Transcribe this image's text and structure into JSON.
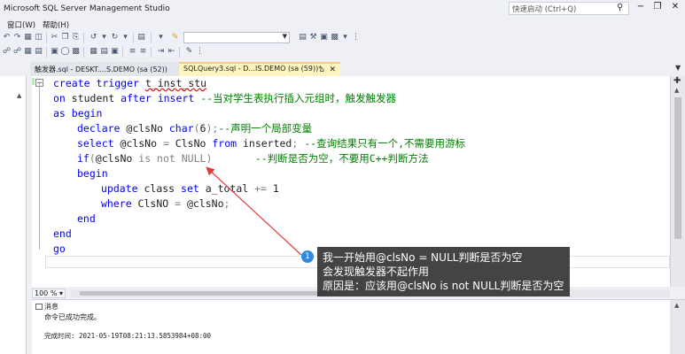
{
  "window": {
    "title": "Microsoft SQL Server Management Studio",
    "quick_launch_placeholder": "快速启动 (Ctrl+Q)",
    "minimize": "−",
    "restore": "❐",
    "close": "✕"
  },
  "menu": {
    "items": [
      "窗口(W)",
      "帮助(H)"
    ]
  },
  "tabs": {
    "inactive_label": "触发器.sql - DESKT....S.DEMO (sa (52))",
    "active_label": "SQLQuery3.sql - D...IS.DEMO (sa (59))*",
    "pin": "⌂",
    "close": "✕",
    "left_pin": "⌂ ✕"
  },
  "code": {
    "l1": {
      "kw1": "create trigger ",
      "name": "t_inst_stu"
    },
    "l2": {
      "kw1": "on ",
      "t1": "student ",
      "kw2": "after insert ",
      "cm": "--当对学生表执行插入元组时，触发触发器"
    },
    "l3": {
      "kw1": "as begin"
    },
    "l4": {
      "kw1": "declare ",
      "t1": "@clsNo ",
      "kw2": "char",
      "p1": "(",
      "n": "6",
      "p2": ");",
      "cm": "--声明一个局部变量"
    },
    "l5": {
      "kw1": "select ",
      "t1": "@clsNo ",
      "p1": "= ",
      "t2": "ClsNo ",
      "kw2": "from ",
      "t3": "inserted",
      "p2": "; ",
      "cm": "--查询结果只有一个,不需要用游标"
    },
    "l6": {
      "kw1": "if",
      "p1": "(",
      "t1": "@clsNo ",
      "g1": "is not NULL",
      "p2": ")",
      "sp": "       ",
      "cm": "--判断是否为空，不要用C++判断方法"
    },
    "l7": {
      "kw1": "begin"
    },
    "l8": {
      "kw1": "update ",
      "t1": "class ",
      "kw2": "set ",
      "t2": "a_total ",
      "p1": "+= ",
      "n": "1"
    },
    "l9": {
      "kw1": "where ",
      "t1": "ClsNO ",
      "p1": "= ",
      "t2": "@clsNo",
      "p2": ";"
    },
    "l10": {
      "kw1": "end"
    },
    "l11": {
      "kw1": "end"
    },
    "l12": {
      "kw1": "go"
    }
  },
  "zoom": {
    "label": "100 %"
  },
  "messages": {
    "tab_label": "消息",
    "line1": "命令已成功完成。",
    "line2": "完成时间: 2021-05-19T08:21:13.5853984+08:00"
  },
  "callout": {
    "badge": "1",
    "line1": "我一开始用@clsNo = NULL判断是否为空",
    "line2": "会发现触发器不起作用",
    "line3": "原因是：应该用@clsNo is not NULL判断是否为空"
  },
  "colors": {
    "keyword": "#0000ff",
    "comment": "#008000",
    "gray_operator": "#808080",
    "number": "#1e1e1e",
    "active_tab": "#fdf4bf",
    "arrow": "#e03c3c",
    "badge": "#2f8ae5"
  }
}
